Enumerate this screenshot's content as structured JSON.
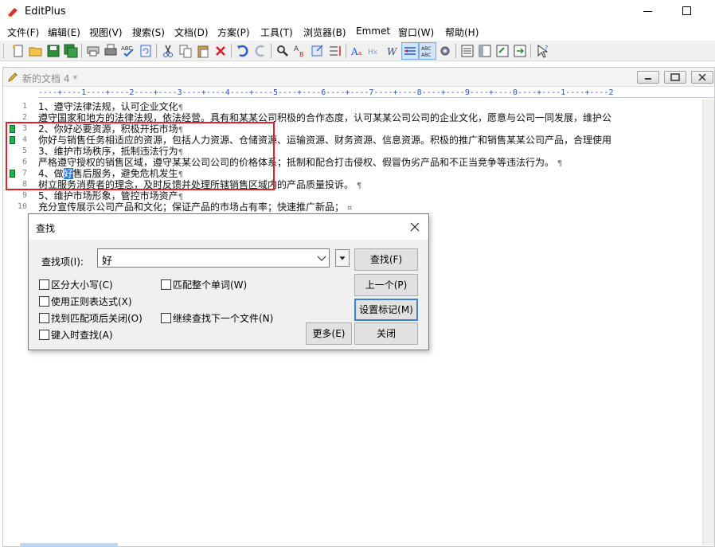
{
  "window": {
    "title": "EditPlus"
  },
  "menu": [
    "文件(F)",
    "编辑(E)",
    "视图(V)",
    "搜索(S)",
    "文档(D)",
    "方案(P)",
    "工具(T)",
    "浏览器(B)",
    "Emmet",
    "窗口(W)",
    "帮助(H)"
  ],
  "toolbar": {
    "icons": [
      "new-file-icon",
      "open-icon",
      "save-icon",
      "save-all-icon",
      "print-preview-icon",
      "print-icon",
      "spell-check-icon",
      "refresh-icon",
      "cut-icon",
      "copy-icon",
      "paste-icon",
      "delete-icon",
      "undo-icon",
      "redo-icon",
      "find-icon",
      "replace-icon",
      "goto-icon",
      "word-wrap-icon",
      "font-icon",
      "hex-icon",
      "word-icon",
      "line-number-icon",
      "ruler-icon",
      "settings-icon",
      "doc-list-icon",
      "cliptext-icon",
      "directory-icon",
      "output-icon",
      "help-icon"
    ]
  },
  "document": {
    "title": "新的文档 4 *",
    "ruler": "----+----1----+----2----+----3----+----4----+----5----+----6----+----7----+----8----+----9----+----0----+----1----+----2",
    "lines": [
      {
        "num": "1",
        "text": "1、遵守法律法规，认可企业文化",
        "end": "¶",
        "bookmark": false
      },
      {
        "num": "2",
        "text": "遵守国家和地方的法律法规，依法经营。具有和某某公司积极的合作态度，认可某某公司公司的企业文化，愿意与公司一同发展，维护公",
        "end": "",
        "bookmark": false
      },
      {
        "num": "3",
        "text": "2、你好必要资源，积极开拓市场",
        "end": "¶",
        "bookmark": true
      },
      {
        "num": "4",
        "text": "你好与销售任务相适应的资源，包括人力资源、仓储资源、运输资源、财务资源、信息资源。积极的推广和销售某某公司产品，合理使用",
        "end": "",
        "bookmark": true
      },
      {
        "num": "5",
        "text": "3、维护市场秩序，抵制违法行为",
        "end": "¶",
        "bookmark": false
      },
      {
        "num": "6",
        "text": "严格遵守授权的销售区域，遵守某某公司公司的价格体系；抵制和配合打击侵权、假冒伪劣产品和不正当竞争等违法行为。",
        "end": "¶",
        "bookmark": false
      },
      {
        "num": "7",
        "pre": "4、做",
        "hit": "好",
        "post": "售后服务，避免危机发生",
        "end": "¶",
        "bookmark": true
      },
      {
        "num": "8",
        "text": "树立服务消费者的理念，及时反馈并处理所辖销售区域内的产品质量投诉。",
        "end": "¶",
        "bookmark": false
      },
      {
        "num": "9",
        "text": "5、维护市场形象，管控市场资产",
        "end": "¶",
        "bookmark": false
      },
      {
        "num": "10",
        "text": "充分宣传展示公司产品和文化；保证产品的市场占有率；快速推广新品；",
        "end": "¤",
        "bookmark": false
      }
    ]
  },
  "find_dialog": {
    "title": "查找",
    "label": "查找项(I):",
    "value": "好",
    "buttons": {
      "find": "查找(F)",
      "prev": "上一个(P)",
      "set_mark": "设置标记(M)",
      "more": "更多(E)",
      "close": "关闭"
    },
    "options": {
      "case": "区分大小写(C)",
      "whole_word": "匹配整个单词(W)",
      "regex": "使用正则表达式(X)",
      "close_on_match": "找到匹配项后关闭(O)",
      "next_file": "继续查找下一个文件(N)",
      "find_as_type": "键入时查找(A)"
    }
  }
}
